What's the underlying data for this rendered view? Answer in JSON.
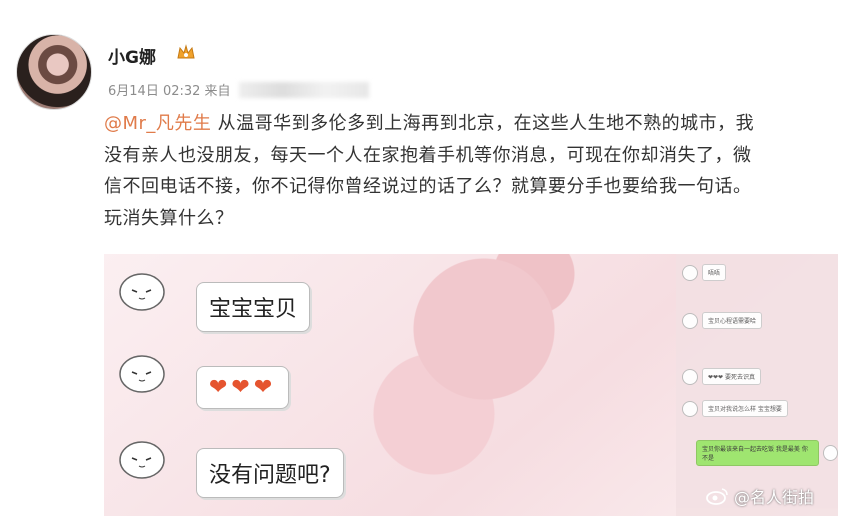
{
  "post": {
    "username": "小G娜",
    "meta_time": "6月14日 02:32 来自",
    "mention": "@Mr_凡先生",
    "text_line1": " 从温哥华到多伦多到上海再到北京，在这些人生地不熟的城市，我",
    "text_line2": "没有亲人也没朋友，每天一个人在家抱着手机等你消息，可现在你却消失了，微",
    "text_line3": "信不回电话不接，你不记得你曾经说过的话了么？就算要分手也要给我一句话。",
    "text_line4": "玩消失算什么？"
  },
  "screenshot": {
    "bubble1": "宝宝宝贝",
    "bubble2": "❤❤❤",
    "bubble3": "没有问题吧?",
    "mini": [
      "唔唔",
      "宝贝心程语需要哈",
      "❤❤❤ 要死去识真",
      "宝贝对我说怎么样 宝宝想要",
      "宝贝你最该来自一起去吃饭 我是最美 你不是"
    ]
  },
  "watermark": {
    "text": "@名人街拍"
  }
}
